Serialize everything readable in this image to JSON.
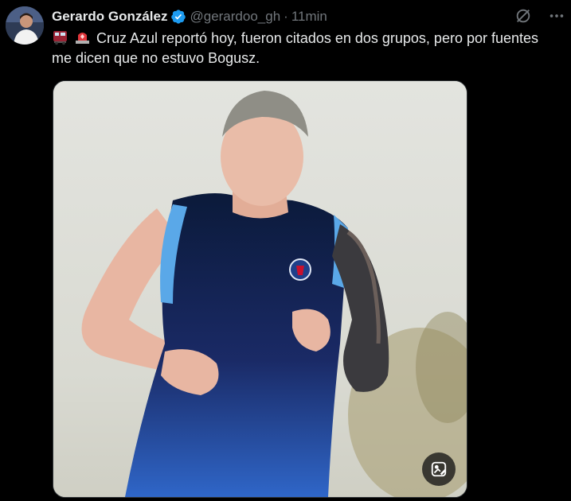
{
  "tweet": {
    "author": {
      "display_name": "Gerardo González",
      "handle": "@gerardoo_gh",
      "verified": true,
      "avatar_icon": "avatar"
    },
    "separator": "·",
    "time": "11min",
    "emojis": [
      "train-emoji",
      "police-light-emoji"
    ],
    "text": "Cruz Azul reportó hoy, fueron citados en dos grupos, pero por fuentes me dicen que no estuvo Bogusz.",
    "actions": {
      "grok_icon": "slash-circle-icon",
      "more_icon": "more-icon"
    },
    "media": {
      "alt_icon": "image-description-icon"
    }
  },
  "colors": {
    "background": "#000000",
    "text": "#e7e9ea",
    "muted": "#71767b",
    "verified": "#1d9bf0"
  }
}
